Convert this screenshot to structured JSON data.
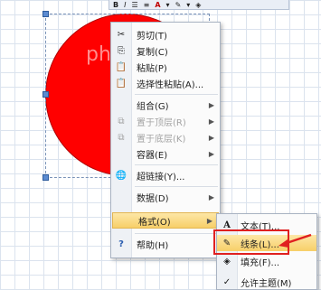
{
  "toolbar": {
    "bold": "B",
    "italic": "I",
    "font_color_icon": "A",
    "line_icon": "pencil-icon"
  },
  "watermark": "php",
  "context_menu": {
    "items": [
      {
        "icon": "✂",
        "label": "剪切(T)",
        "submenu": false,
        "disabled": false
      },
      {
        "icon": "⎘",
        "label": "复制(C)",
        "submenu": false,
        "disabled": false
      },
      {
        "icon": "📋",
        "label": "粘贴(P)",
        "submenu": false,
        "disabled": false
      },
      {
        "icon": "📋",
        "label": "选择性粘贴(A)...",
        "submenu": false,
        "disabled": false
      },
      {
        "icon": "",
        "label": "组合(G)",
        "submenu": true,
        "disabled": false
      },
      {
        "icon": "⧉",
        "label": "置于顶层(R)",
        "submenu": true,
        "disabled": true
      },
      {
        "icon": "⧉",
        "label": "置于底层(K)",
        "submenu": true,
        "disabled": true
      },
      {
        "icon": "",
        "label": "容器(E)",
        "submenu": true,
        "disabled": false
      },
      {
        "icon": "🌐",
        "label": "超链接(Y)...",
        "submenu": false,
        "disabled": false
      },
      {
        "icon": "",
        "label": "数据(D)",
        "submenu": true,
        "disabled": false
      },
      {
        "icon": "",
        "label": "格式(O)",
        "submenu": true,
        "disabled": false,
        "highlighted": true
      },
      {
        "icon": "?",
        "label": "帮助(H)",
        "submenu": false,
        "disabled": false
      }
    ]
  },
  "format_submenu": {
    "items": [
      {
        "icon": "A",
        "label": "文本(T)..."
      },
      {
        "icon": "✎",
        "label": "线条(L)...",
        "highlighted": true
      },
      {
        "icon": "◈",
        "label": "填充(F)..."
      },
      {
        "icon": "✓",
        "label": "允许主题(M)"
      }
    ]
  },
  "colors": {
    "shape_fill": "#ff0000",
    "highlight": "#f7cf68",
    "annotation": "#e02020"
  }
}
